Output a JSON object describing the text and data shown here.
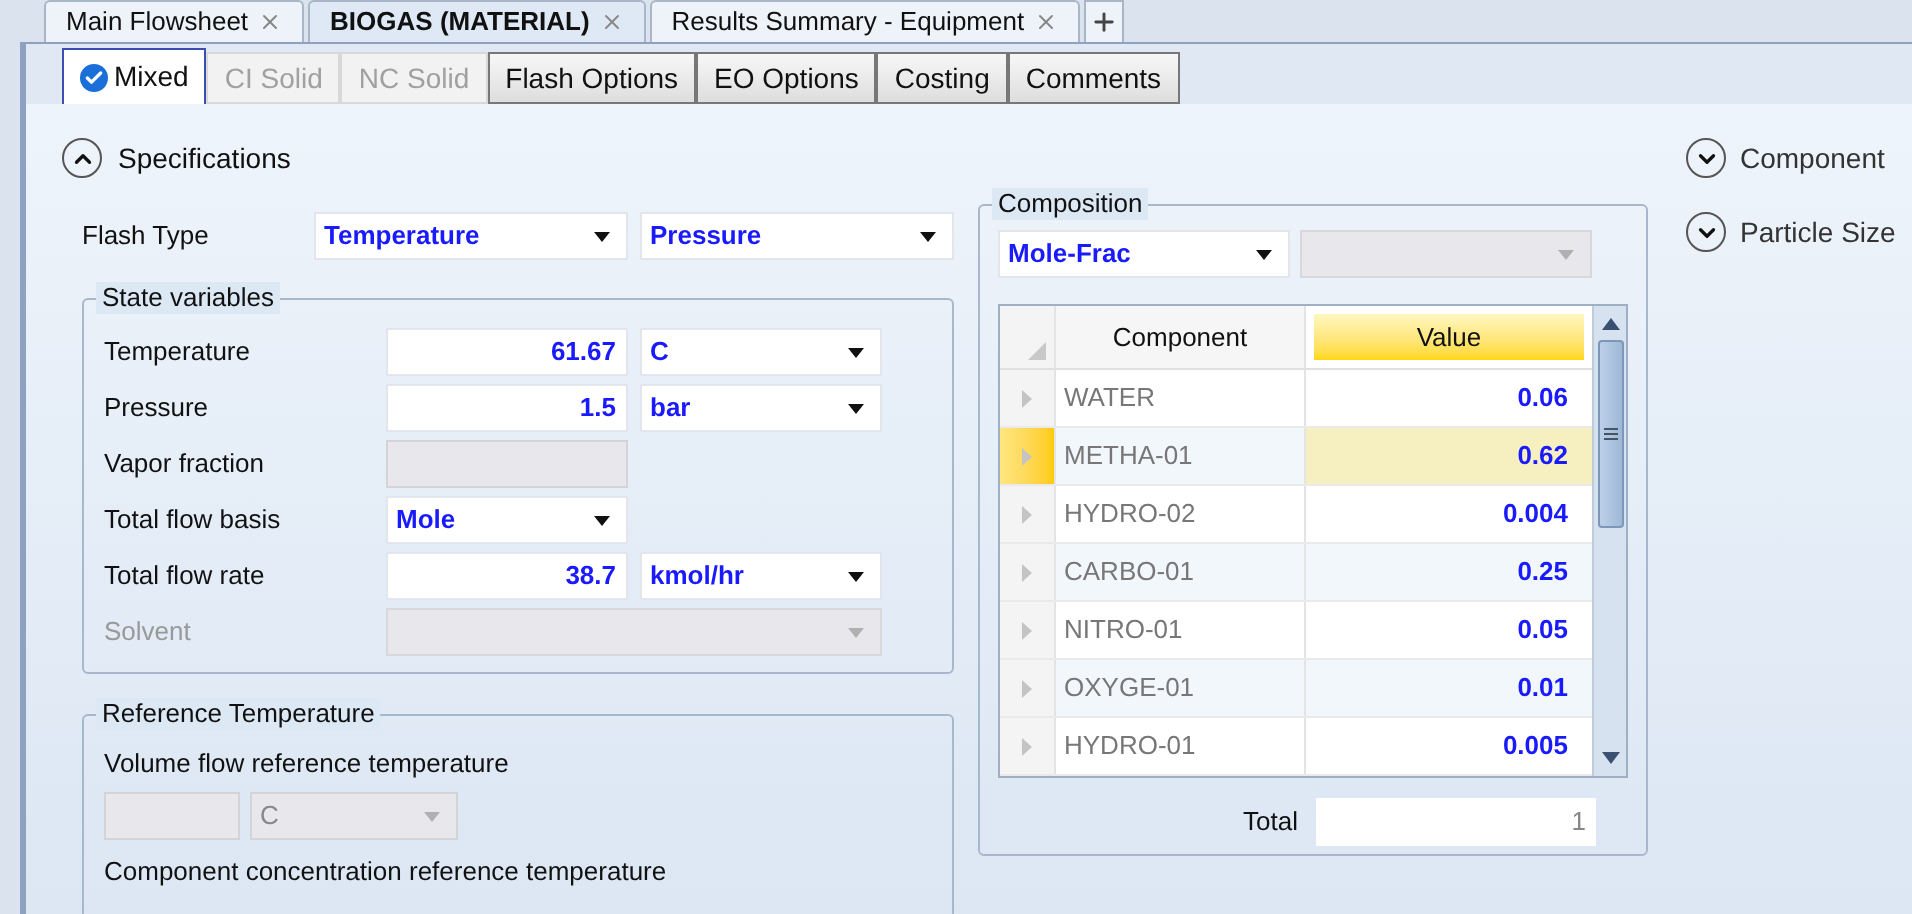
{
  "document_tabs": [
    {
      "label": "Main Flowsheet",
      "selected": false
    },
    {
      "label": "BIOGAS (MATERIAL)",
      "selected": true
    },
    {
      "label": "Results Summary - Equipment",
      "selected": false
    }
  ],
  "form_tabs": [
    {
      "label": "Mixed",
      "selected": true,
      "disabled": false,
      "validated": true
    },
    {
      "label": "CI Solid",
      "selected": false,
      "disabled": true,
      "validated": false
    },
    {
      "label": "NC Solid",
      "selected": false,
      "disabled": true,
      "validated": false
    },
    {
      "label": "Flash Options",
      "selected": false,
      "disabled": false,
      "validated": false
    },
    {
      "label": "EO Options",
      "selected": false,
      "disabled": false,
      "validated": false
    },
    {
      "label": "Costing",
      "selected": false,
      "disabled": false,
      "validated": false
    },
    {
      "label": "Comments",
      "selected": false,
      "disabled": false,
      "validated": false
    }
  ],
  "specifications": {
    "label": "Specifications",
    "expanded": true
  },
  "side_sections": [
    {
      "label": "Component",
      "expanded": false
    },
    {
      "label": "Particle Size",
      "expanded": false
    }
  ],
  "flash_type": {
    "label": "Flash Type",
    "options": [
      "Temperature",
      "Pressure"
    ]
  },
  "state_variables": {
    "title": "State variables",
    "rows": [
      {
        "label": "Temperature",
        "kind": "number_unit",
        "value": "61.67",
        "unit": "C",
        "disabled": false
      },
      {
        "label": "Pressure",
        "kind": "number_unit",
        "value": "1.5",
        "unit": "bar",
        "disabled": false
      },
      {
        "label": "Vapor fraction",
        "kind": "number",
        "disabled": true
      },
      {
        "label": "Total flow basis",
        "kind": "dropdown",
        "value": "Mole",
        "disabled": false
      },
      {
        "label": "Total flow rate",
        "kind": "number_unit",
        "value": "38.7",
        "unit": "kmol/hr",
        "disabled": false
      },
      {
        "label": "Solvent",
        "kind": "wide_dropdown",
        "disabled": true
      }
    ]
  },
  "reference_temperature": {
    "title": "Reference Temperature",
    "volume_flow_label": "Volume flow reference temperature",
    "volume_flow_unit": "C",
    "volume_flow_disabled": true,
    "concentration_label": "Component concentration reference temperature"
  },
  "composition": {
    "title": "Composition",
    "basis": "Mole-Frac",
    "columns": [
      {
        "label": "Component",
        "selected": false
      },
      {
        "label": "Value",
        "selected": true
      }
    ],
    "rows": [
      {
        "component": "WATER",
        "value": "0.06",
        "selected": false
      },
      {
        "component": "METHA-01",
        "value": "0.62",
        "selected": true
      },
      {
        "component": "HYDRO-02",
        "value": "0.004",
        "selected": false
      },
      {
        "component": "CARBO-01",
        "value": "0.25",
        "selected": false
      },
      {
        "component": "NITRO-01",
        "value": "0.05",
        "selected": false
      },
      {
        "component": "OXYGE-01",
        "value": "0.01",
        "selected": false
      },
      {
        "component": "HYDRO-01",
        "value": "0.005",
        "selected": false
      }
    ],
    "total": {
      "label": "Total",
      "value": "1"
    }
  }
}
